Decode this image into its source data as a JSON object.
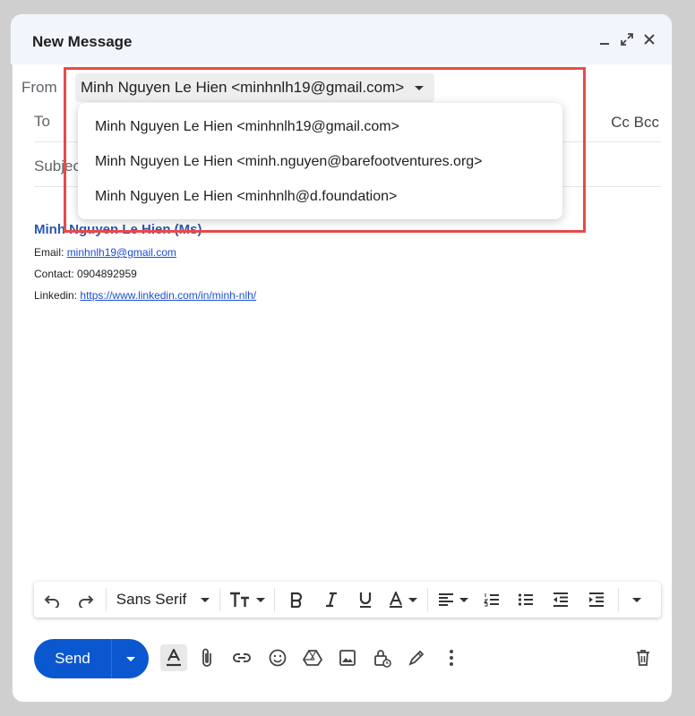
{
  "window": {
    "title": "New Message"
  },
  "from": {
    "label": "From",
    "selected": "Minh Nguyen Le Hien <minhnlh19@gmail.com>"
  },
  "to": {
    "label": "To",
    "cc_bcc": "Cc Bcc"
  },
  "subject": {
    "label": "Subject"
  },
  "from_options": [
    "Minh Nguyen Le Hien <minhnlh19@gmail.com>",
    "Minh Nguyen Le Hien <minh.nguyen@barefootventures.org>",
    "Minh Nguyen Le Hien <minhnlh@d.foundation>"
  ],
  "signature": {
    "name": "Minh Nguyen Le Hien (Ms)",
    "email_label": "Email:",
    "email": "minhnlh19@gmail.com",
    "contact_label": "Contact:",
    "contact": "0904892959",
    "linkedin_label": "Linkedin:",
    "linkedin": "https://www.linkedin.com/in/minh-nlh/"
  },
  "toolbar": {
    "font": "Sans Serif"
  },
  "send": {
    "label": "Send"
  }
}
